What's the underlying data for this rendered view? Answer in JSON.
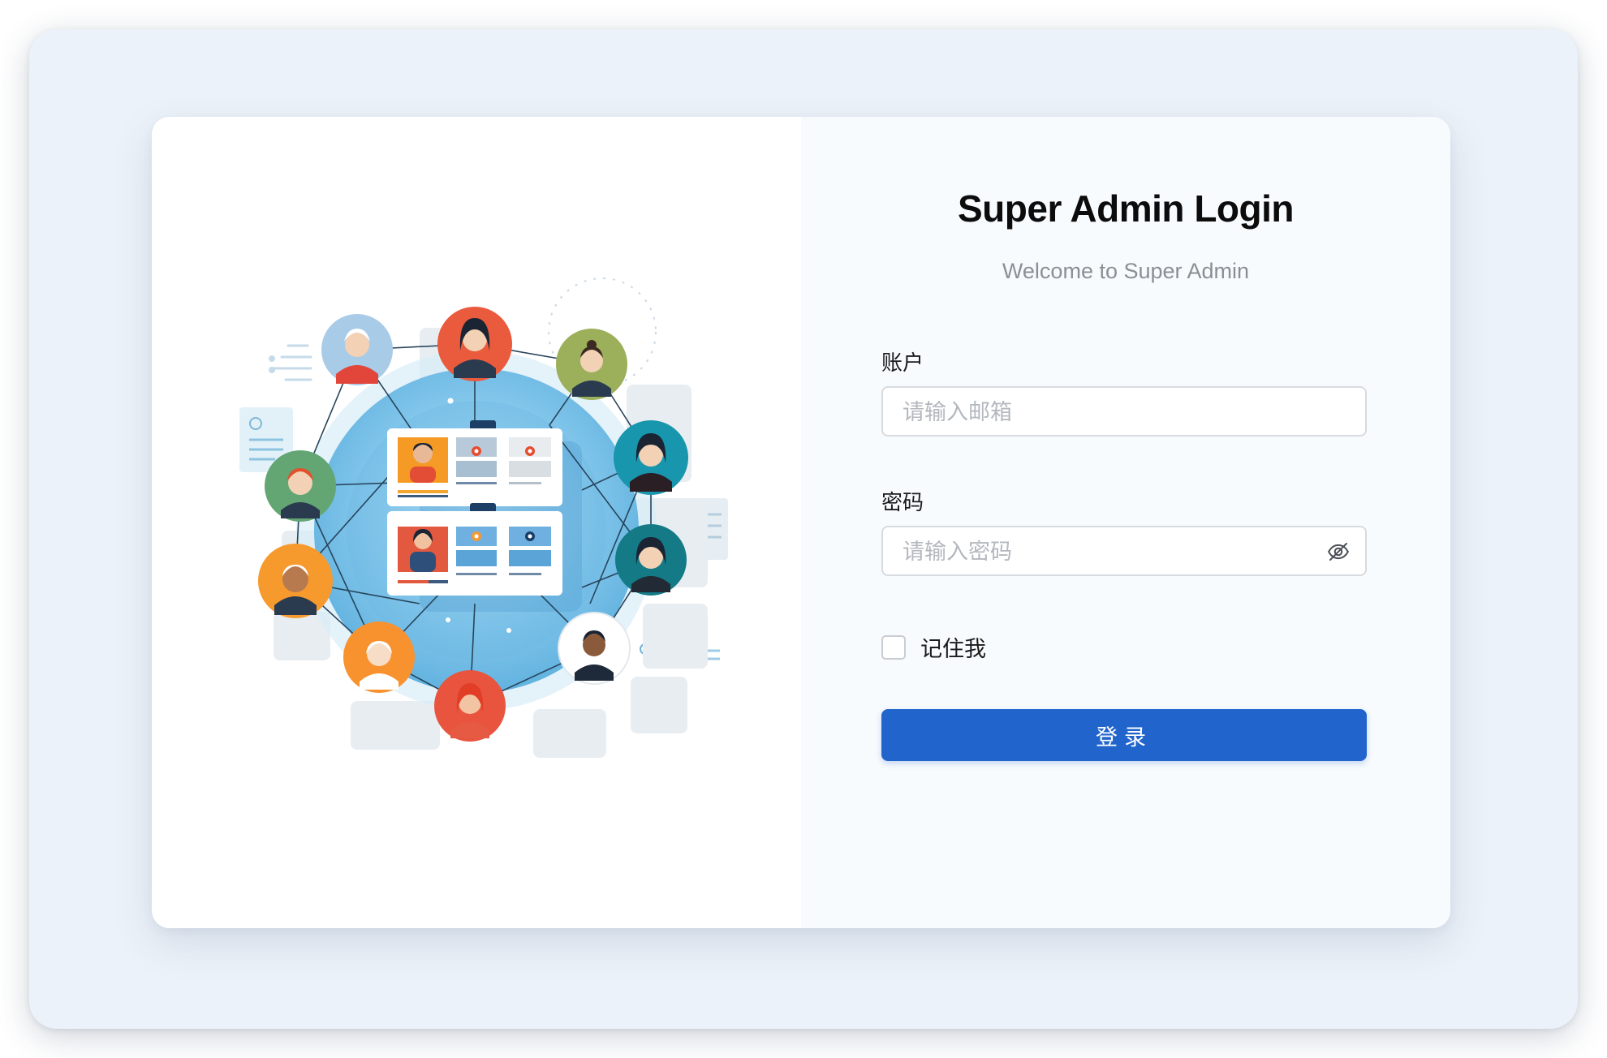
{
  "login": {
    "title": "Super Admin Login",
    "subtitle": "Welcome to Super Admin",
    "account_label": "账户",
    "account_placeholder": "请输入邮箱",
    "account_value": "",
    "password_label": "密码",
    "password_placeholder": "请输入密码",
    "password_value": "",
    "password_toggle_icon": "eye-off-icon",
    "remember_label": "记住我",
    "remember_checked": false,
    "submit_label": "登录"
  },
  "colors": {
    "page_background": "#ecf2f9",
    "card_background": "#ffffff",
    "form_background": "#f8fbfe",
    "primary": "#2165cc",
    "input_border": "#d7dbe0",
    "placeholder": "#b4b8be",
    "subtitle": "#8a8f96"
  },
  "illustration": {
    "name": "user-network-illustration",
    "avatar_colors": [
      "#a8cbe8",
      "#ea5a3c",
      "#9caf5a",
      "#63a673",
      "#1896ad",
      "#f79a2e",
      "#137a86",
      "#f7922f",
      "#e8543e",
      "#ffffff"
    ]
  }
}
